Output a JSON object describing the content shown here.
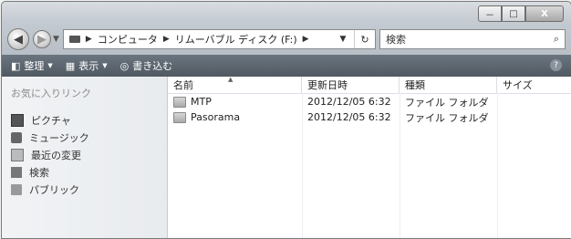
{
  "window": {
    "caption": {
      "minimize": "－",
      "maximize": "□",
      "close": "X"
    }
  },
  "address": {
    "back_glyph": "◀",
    "forward_glyph": "▶",
    "history_glyph": "▼",
    "crumbs": [
      "コンピュータ",
      "リムーバブル ディスク (F:)"
    ],
    "crumb_sep": "▶",
    "dropdown_glyph": "▼",
    "refresh_glyph": "↻"
  },
  "search": {
    "placeholder": "検索",
    "icon_glyph": "⌕"
  },
  "toolbar": {
    "organize": "整理",
    "views": "表示",
    "burn": "書き込む",
    "dropdown_glyph": "▼",
    "help_glyph": "?"
  },
  "nav": {
    "title": "お気に入りリンク",
    "items": [
      {
        "label": "ピクチャ",
        "icon": "pictures-icon"
      },
      {
        "label": "ミュージック",
        "icon": "music-icon"
      },
      {
        "label": "最近の変更",
        "icon": "recent-icon"
      },
      {
        "label": "検索",
        "icon": "search-icon"
      },
      {
        "label": "パブリック",
        "icon": "public-icon"
      }
    ]
  },
  "list": {
    "columns": {
      "name": "名前",
      "date": "更新日時",
      "type": "種類",
      "size": "サイズ"
    },
    "sort_glyph": "▲",
    "rows": [
      {
        "name": "MTP",
        "date": "2012/12/05 6:32",
        "type": "ファイル フォルダ"
      },
      {
        "name": "Pasorama",
        "date": "2012/12/05 6:32",
        "type": "ファイル フォルダ"
      }
    ]
  }
}
